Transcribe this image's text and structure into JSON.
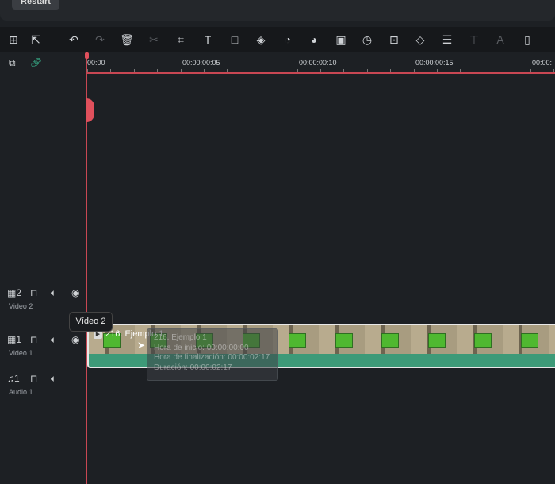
{
  "top": {
    "restart_label": "Restart"
  },
  "toolbar": {
    "items": [
      {
        "name": "layout-icon",
        "glyph": "⊞"
      },
      {
        "name": "select-icon",
        "glyph": "⇱"
      },
      {
        "name": "undo-icon",
        "glyph": "↶"
      },
      {
        "name": "redo-icon",
        "glyph": "↷",
        "disabled": true
      },
      {
        "name": "delete-icon",
        "glyph": "🗑"
      },
      {
        "name": "cut-icon",
        "glyph": "✂",
        "disabled": true
      },
      {
        "name": "crop-icon",
        "glyph": "⌗"
      },
      {
        "name": "text-icon",
        "glyph": "T"
      },
      {
        "name": "shape-icon",
        "glyph": "□"
      },
      {
        "name": "mask-icon",
        "glyph": "◈"
      },
      {
        "name": "speed-icon",
        "glyph": "◔"
      },
      {
        "name": "color-icon",
        "glyph": "◕"
      },
      {
        "name": "ai-portrait-icon",
        "glyph": "▣"
      },
      {
        "name": "timer-icon",
        "glyph": "◷"
      },
      {
        "name": "auto-reframe-icon",
        "glyph": "⊡"
      },
      {
        "name": "keyframe-icon",
        "glyph": "◇"
      },
      {
        "name": "adjust-icon",
        "glyph": "☰"
      },
      {
        "name": "speech-to-text-icon",
        "glyph": "⊤",
        "disabled": true
      },
      {
        "name": "translate-icon",
        "glyph": "A",
        "disabled": true
      },
      {
        "name": "freeze-frame-icon",
        "glyph": "▯"
      }
    ]
  },
  "ruler": {
    "labels": [
      "00:00",
      "00:00:00:05",
      "00:00:00:10",
      "00:00:00:15",
      "00:00:"
    ]
  },
  "tracks": [
    {
      "icon": "video-track-icon",
      "number": "2",
      "label": "Video 2"
    },
    {
      "icon": "video-track-icon",
      "number": "1",
      "label": "Video 1"
    },
    {
      "icon": "audio-track-icon",
      "number": "1",
      "label": "Audio 1"
    }
  ],
  "tooltip": "Vídeo 2",
  "clip": {
    "title": "216. Ejemplo 1"
  },
  "clip_info": {
    "name": "216. Ejemplo 1",
    "start": "Hora de inicio: 00:00:00:00",
    "end": "Hora de finalización: 00:00:02:17",
    "duration": "Duración: 00:00:02:17"
  }
}
